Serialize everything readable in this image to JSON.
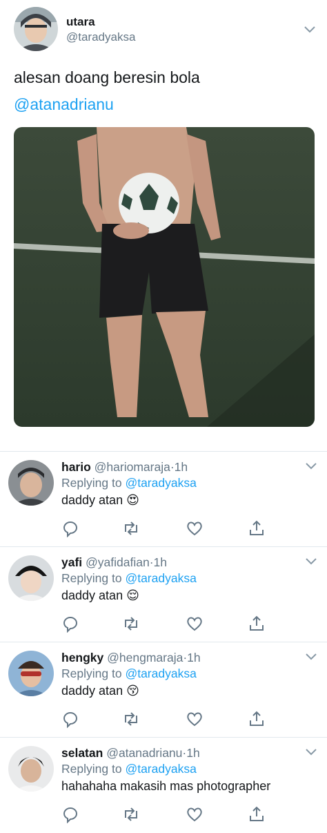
{
  "tweet": {
    "name": "utara",
    "handle": "@taradyaksa",
    "text": "alesan doang beresin bola",
    "mention": "@atanadrianu",
    "photo_icon": "soccer-player-photo"
  },
  "replies": [
    {
      "name": "hario",
      "handle": "@hariomaraja",
      "sep": "·",
      "time": "1h",
      "replying_label": "Replying to",
      "replying_to": "@taradyaksa",
      "text": "daddy atan",
      "emoji": "😍"
    },
    {
      "name": "yafi",
      "handle": "@yafidafian",
      "sep": "·",
      "time": "1h",
      "replying_label": "Replying to",
      "replying_to": "@taradyaksa",
      "text": "daddy atan",
      "emoji": "😌"
    },
    {
      "name": "hengky",
      "handle": "@hengmaraja",
      "sep": "·",
      "time": "1h",
      "replying_label": "Replying to",
      "replying_to": "@taradyaksa",
      "text": "daddy atan",
      "emoji": "😚"
    },
    {
      "name": "selatan",
      "handle": "@atanadrianu",
      "sep": "·",
      "time": "1h",
      "replying_label": "Replying to",
      "replying_to": "@taradyaksa",
      "text": "hahahaha makasih mas photographer",
      "emoji": ""
    }
  ],
  "icons": {
    "reply": "reply-icon",
    "retweet": "retweet-icon",
    "like": "heart-icon",
    "share": "share-icon",
    "menu": "chevron-down-icon"
  },
  "colors": {
    "link": "#1da1f2",
    "secondary": "#657786",
    "divider": "#e1e8ed"
  }
}
